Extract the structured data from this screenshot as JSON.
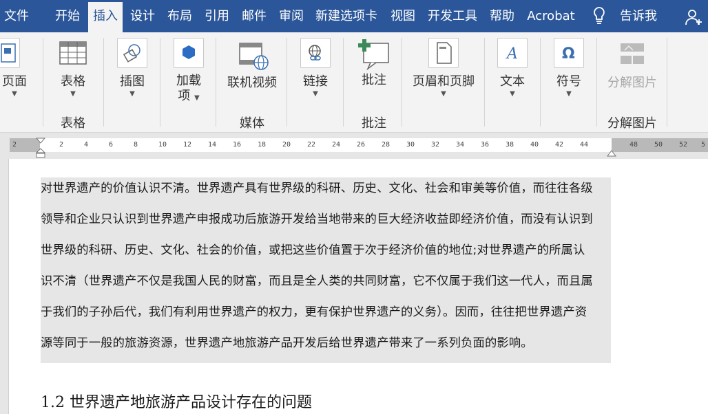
{
  "tabs": [
    {
      "label": "文件",
      "active": false
    },
    {
      "label": "开始",
      "active": false
    },
    {
      "label": "插入",
      "active": true
    },
    {
      "label": "设计",
      "active": false
    },
    {
      "label": "布局",
      "active": false
    },
    {
      "label": "引用",
      "active": false
    },
    {
      "label": "邮件",
      "active": false
    },
    {
      "label": "审阅",
      "active": false
    },
    {
      "label": "新建选项卡",
      "active": false
    },
    {
      "label": "视图",
      "active": false
    },
    {
      "label": "开发工具",
      "active": false
    },
    {
      "label": "帮助",
      "active": false
    },
    {
      "label": "Acrobat",
      "active": false
    }
  ],
  "tell_me": "告诉我",
  "ribbon": {
    "buttons": {
      "page": "页面",
      "table": "表格",
      "illustration": "插图",
      "addins": [
        "加载",
        "项"
      ],
      "online_video": "联机视频",
      "link": "链接",
      "comment": "批注",
      "header_footer": "页眉和页脚",
      "text": "文本",
      "symbol": "符号",
      "split_image": "分解图片"
    },
    "groups": {
      "table": "表格",
      "media": "媒体",
      "comments": "批注",
      "split_image": "分解图片"
    }
  },
  "ruler": {
    "ticks": [
      "2",
      "2",
      "4",
      "6",
      "8",
      "10",
      "12",
      "14",
      "16",
      "18",
      "20",
      "22",
      "24",
      "26",
      "28",
      "30",
      "32",
      "34",
      "36",
      "38",
      "40",
      "42",
      "44",
      "48",
      "50",
      "52",
      "5"
    ]
  },
  "document": {
    "lines": [
      "对世界遗产的价值认识不清。世界遗产具有世界级的科研、历史、文化、社会和审美等价值，而往往各级",
      "领导和企业只认识到世界遗产申报成功后旅游开发给当地带来的巨大经济收益即经济价值，而没有认识到",
      "世界级的科研、历史、文化、社会的价值，或把这些价值置于次于经济价值的地位;对世界遗产的所属认",
      "识不清（世界遗产不仅是我国人民的财富，而且是全人类的共同财富，它不仅属于我们这一代人，而且属",
      "于我们的子孙后代，我们有利用世界遗产的权力，更有保护世界遗产的义务）。因而，往往把世界遗产资",
      "源等同于一般的旅游资源，世界遗产地旅游产品开发后给世界遗产带来了一系列负面的影响。"
    ],
    "heading": "1.2  世界遗产地旅游产品设计存在的问题"
  },
  "colors": {
    "ribbon_blue": "#2b579a",
    "ribbon_bg": "#f3f3f3",
    "highlight": "#e6e6e6"
  }
}
